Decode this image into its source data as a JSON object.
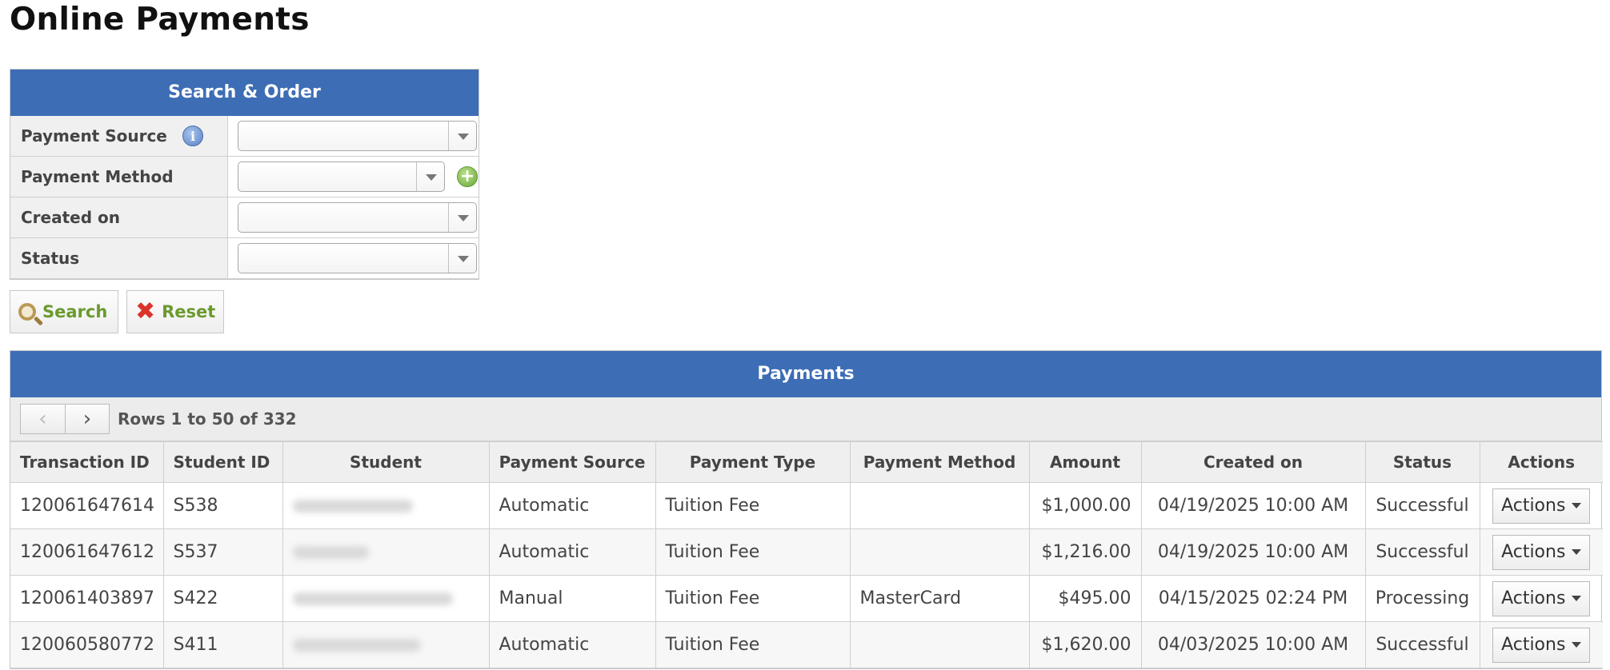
{
  "page": {
    "title": "Online Payments"
  },
  "search": {
    "header": "Search & Order",
    "fields": [
      {
        "label": "Payment Source",
        "value": ""
      },
      {
        "label": "Payment Method",
        "value": ""
      },
      {
        "label": "Created on",
        "value": ""
      },
      {
        "label": "Status",
        "value": ""
      }
    ],
    "search_label": "Search",
    "reset_label": "Reset"
  },
  "payments": {
    "header": "Payments",
    "pager_text": "Rows 1 to 50 of 332",
    "columns": [
      "Transaction ID",
      "Student ID",
      "Student",
      "Payment Source",
      "Payment Type",
      "Payment Method",
      "Amount",
      "Created on",
      "Status",
      "Actions"
    ],
    "rows": [
      {
        "transaction_id": "120061647614",
        "student_id": "S538",
        "source": "Automatic",
        "type": "Tuition Fee",
        "method": "",
        "amount": "$1,000.00",
        "created": "04/19/2025 10:00 AM",
        "status": "Successful",
        "action": "Actions"
      },
      {
        "transaction_id": "120061647612",
        "student_id": "S537",
        "source": "Automatic",
        "type": "Tuition Fee",
        "method": "",
        "amount": "$1,216.00",
        "created": "04/19/2025 10:00 AM",
        "status": "Successful",
        "action": "Actions"
      },
      {
        "transaction_id": "120061403897",
        "student_id": "S422",
        "source": "Manual",
        "type": "Tuition Fee",
        "method": "MasterCard",
        "amount": "$495.00",
        "created": "04/15/2025 02:24 PM",
        "status": "Processing",
        "action": "Actions"
      },
      {
        "transaction_id": "120060580772",
        "student_id": "S411",
        "source": "Automatic",
        "type": "Tuition Fee",
        "method": "",
        "amount": "$1,620.00",
        "created": "04/03/2025 10:00 AM",
        "status": "Successful",
        "action": "Actions"
      }
    ]
  },
  "colors": {
    "header_blue": "#3d6db5",
    "link_blue": "#2c62a8",
    "button_green": "#6b9a2d"
  }
}
